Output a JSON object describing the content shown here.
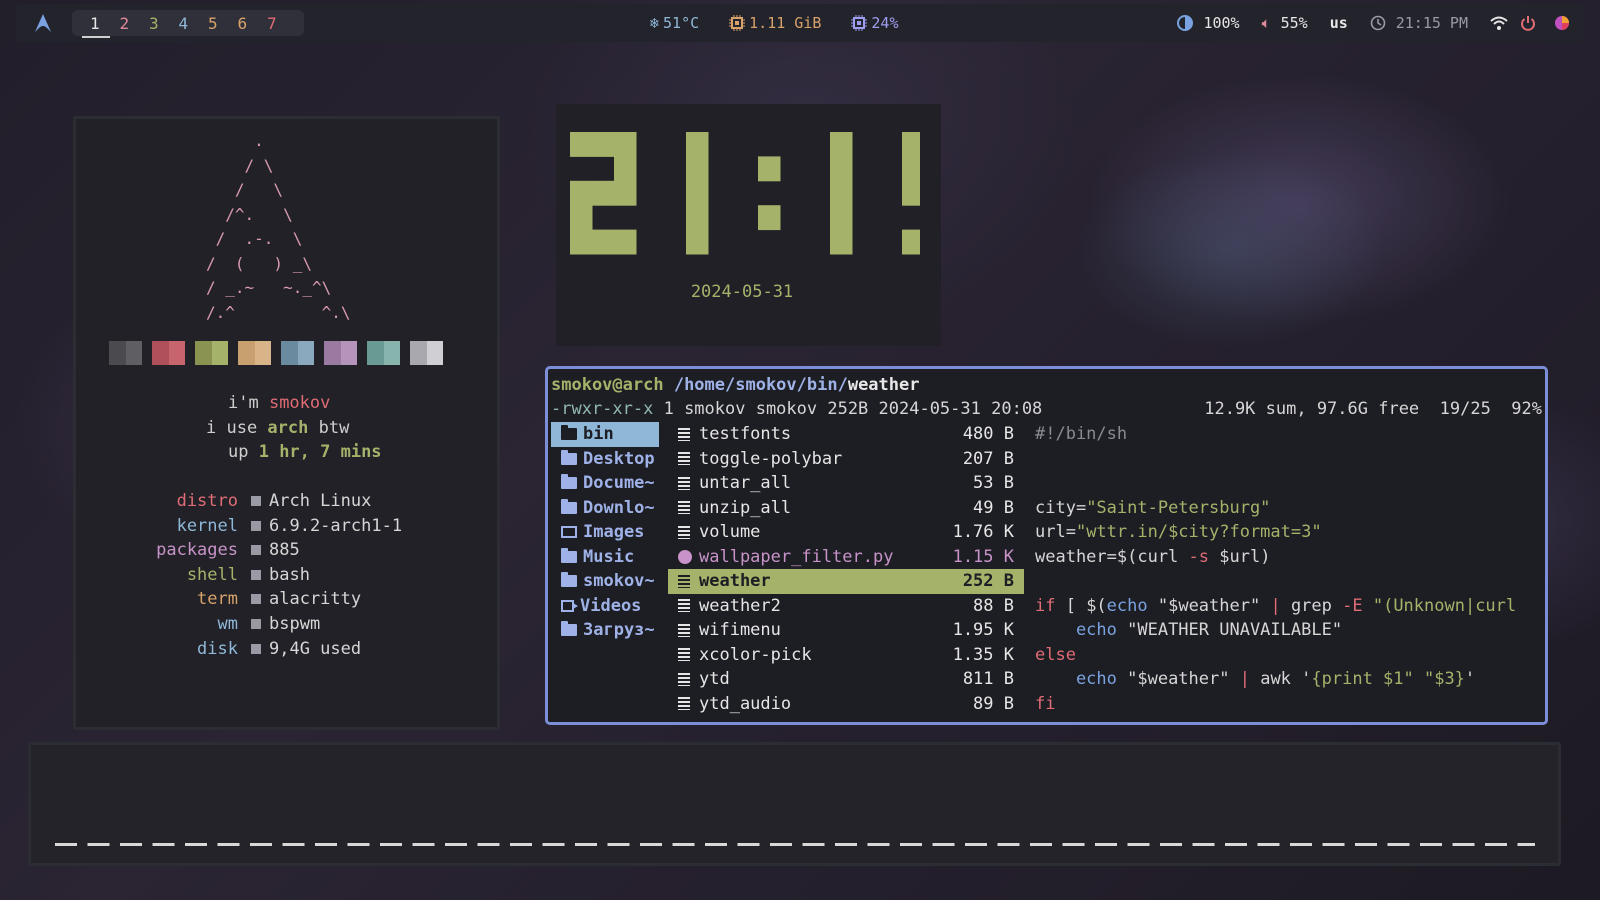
{
  "topbar": {
    "workspaces": [
      "1",
      "2",
      "3",
      "4",
      "5",
      "6",
      "7"
    ],
    "active_workspace": "1",
    "workspace_colors": [
      "#e6e6e6",
      "#e08a9a",
      "#a4b26a",
      "#8fb8d8",
      "#d8a26b",
      "#d8a26b",
      "#e06c75"
    ],
    "temp": "51°C",
    "memory": "1.11 GiB",
    "cpu": "24%",
    "brightness": "100%",
    "volume": "55%",
    "layout": "us",
    "time": "21:15 PM"
  },
  "fetch": {
    "ascii_logo": "     .\n    / \\\n   /   \\\n  /^.   \\\n /  .-.  \\\n/  (   ) _\\\n/ _.~   ~._^\\\n/.^         ^.\\",
    "swatches": [
      [
        "#4a4a4f",
        "#5e5e63"
      ],
      [
        "#b0505a",
        "#c8646e"
      ],
      [
        "#8a9450",
        "#a4b26a"
      ],
      [
        "#c8a070",
        "#d8b488"
      ],
      [
        "#6a8aa0",
        "#8aa8be"
      ],
      [
        "#9a7aa0",
        "#b494ba"
      ],
      [
        "#6a9a94",
        "#88b4ae"
      ],
      [
        "#a8a8ae",
        "#d0d0d4"
      ]
    ],
    "intro": {
      "im": "i'm ",
      "user": "smokov",
      "use_pre": "i use ",
      "distro_word": "arch",
      "use_post": " btw",
      "up_pre": "up ",
      "uptime": "1 hr, 7 mins"
    },
    "info": [
      {
        "key": "distro",
        "value": "Arch Linux",
        "color": "#e06c75"
      },
      {
        "key": "kernel",
        "value": "6.9.2-arch1-1",
        "color": "#8fb8d8"
      },
      {
        "key": "packages",
        "value": "885",
        "color": "#c893c8"
      },
      {
        "key": "shell",
        "value": "bash",
        "color": "#a4b26a"
      },
      {
        "key": "term",
        "value": "alacritty",
        "color": "#d8a26b"
      },
      {
        "key": "wm",
        "value": "bspwm",
        "color": "#8fb8d8"
      },
      {
        "key": "disk",
        "value": "9,4G used",
        "color": "#8fb8d8"
      }
    ]
  },
  "clock": {
    "time": "21:15",
    "date": "2024-05-31",
    "color": "#a4b26a"
  },
  "fm": {
    "host": "smokov@arch",
    "dir": " /home/smokov/bin/",
    "file": "weather",
    "perm": "-rwxr-xr-x",
    "perm_rest": " 1 smokov smokov 252B 2024-05-31 20:08",
    "stats": "12.9K sum, 97.6G free  19/25  92%",
    "left": [
      {
        "name": "bin",
        "icon": "folder",
        "selected": true
      },
      {
        "name": "Desktop",
        "icon": "folder"
      },
      {
        "name": "Docume~",
        "icon": "folder"
      },
      {
        "name": "Downlo~",
        "icon": "folder"
      },
      {
        "name": "Images",
        "icon": "image"
      },
      {
        "name": "Music",
        "icon": "folder"
      },
      {
        "name": "smokov~",
        "icon": "folder"
      },
      {
        "name": "Videos",
        "icon": "video"
      },
      {
        "name": "Загруз~",
        "icon": "folder"
      }
    ],
    "files": [
      {
        "name": "testfonts",
        "size": "480 B"
      },
      {
        "name": "toggle-polybar",
        "size": "207 B"
      },
      {
        "name": "untar_all",
        "size": "53 B"
      },
      {
        "name": "unzip_all",
        "size": "49 B"
      },
      {
        "name": "volume",
        "size": "1.76 K"
      },
      {
        "name": "wallpaper_filter.py",
        "size": "1.15 K",
        "type": "py"
      },
      {
        "name": "weather",
        "size": "252 B",
        "selected": true
      },
      {
        "name": "weather2",
        "size": "88 B"
      },
      {
        "name": "wifimenu",
        "size": "1.95 K"
      },
      {
        "name": "xcolor-pick",
        "size": "1.35 K"
      },
      {
        "name": "ytd",
        "size": "811 B"
      },
      {
        "name": "ytd_audio",
        "size": "89 B"
      }
    ],
    "preview": {
      "l1": "#!/bin/sh",
      "l4a": "city=",
      "l4b": "\"Saint-Petersburg\"",
      "l5a": "url=",
      "l5b": "\"wttr.in/$city?format=3\"",
      "l6a": "weather=$(curl ",
      "l6b": "-s",
      "l6c": " $url)",
      "l8a": "if",
      "l8b": " [ $(",
      "l8c": "echo",
      "l8d": " \"$weather\" ",
      "l8e": "|",
      "l8f": " grep ",
      "l8g": "-E",
      "l8h": " \"(Unknown|curl",
      "l9a": "    echo",
      "l9b": " \"WEATHER UNAVAILABLE\"",
      "l10": "else",
      "l11a": "    echo",
      "l11b": " \"$weather\" ",
      "l11c": "|",
      "l11d": " awk '",
      "l11e": "{print $1\" \"$3}",
      "l11f": "'",
      "l12": "fi"
    }
  }
}
